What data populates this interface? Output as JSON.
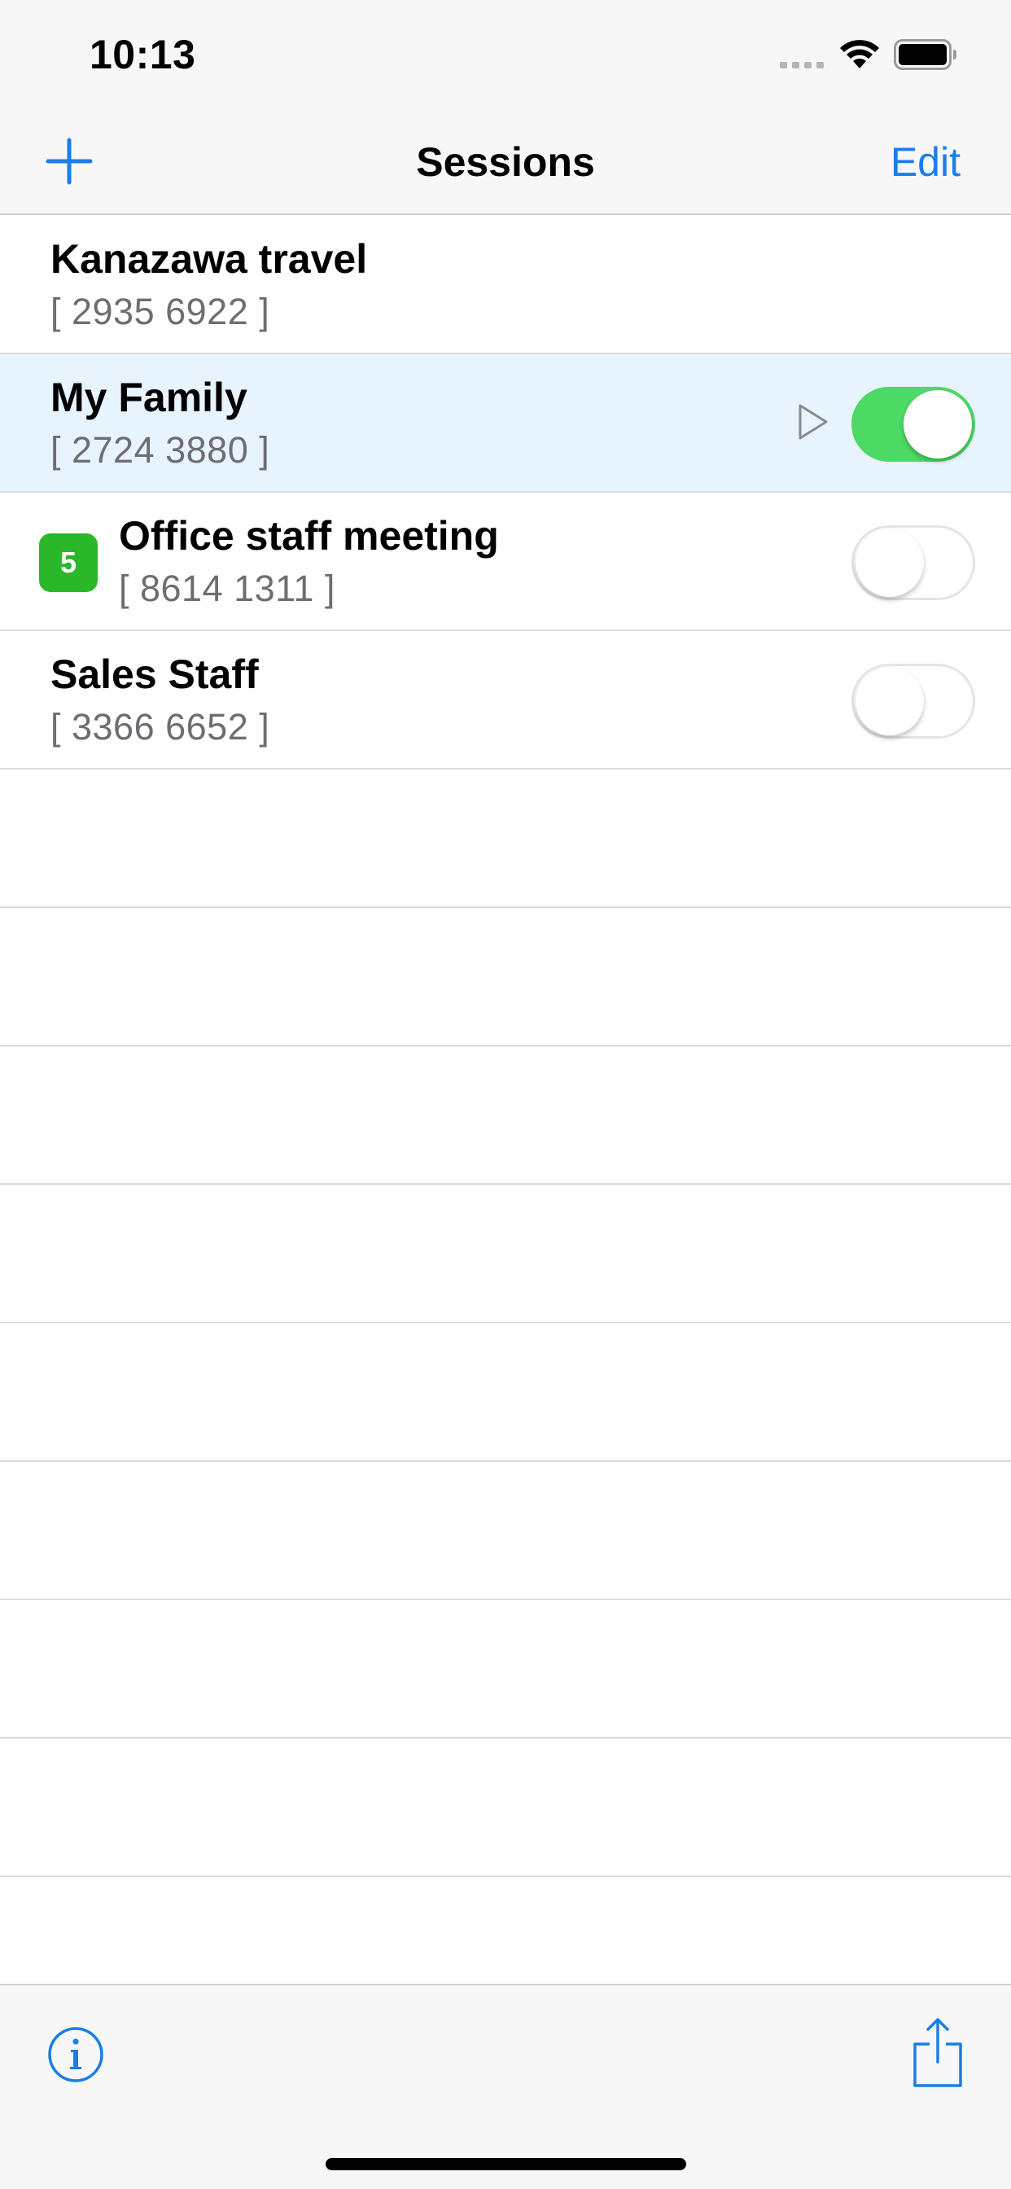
{
  "status_bar": {
    "time": "10:13",
    "signal_icon": "cellular-signal-icon",
    "wifi_icon": "wifi-icon",
    "battery_icon": "battery-icon"
  },
  "nav_bar": {
    "add_icon": "plus-icon",
    "title": "Sessions",
    "edit_label": "Edit"
  },
  "sessions": [
    {
      "title": "Kanazawa travel",
      "code": "[ 2935 6922 ]",
      "selected": false,
      "has_toggle": false
    },
    {
      "title": "My Family",
      "code": "[ 2724 3880 ]",
      "selected": true,
      "playing": true,
      "has_toggle": true,
      "toggle_on": true
    },
    {
      "title": "Office staff meeting",
      "code": "[ 8614 1311 ]",
      "badge": "5",
      "selected": false,
      "has_toggle": true,
      "toggle_on": false
    },
    {
      "title": "Sales Staff",
      "code": "[ 3366 6652 ]",
      "selected": false,
      "has_toggle": true,
      "toggle_on": false
    }
  ],
  "toolbar": {
    "info_icon": "info-icon",
    "share_icon": "share-icon"
  },
  "colors": {
    "accent": "#1a7ee8",
    "toggle_on": "#4cd964",
    "badge": "#2ab82a",
    "selected_row": "#e7f3fd"
  }
}
